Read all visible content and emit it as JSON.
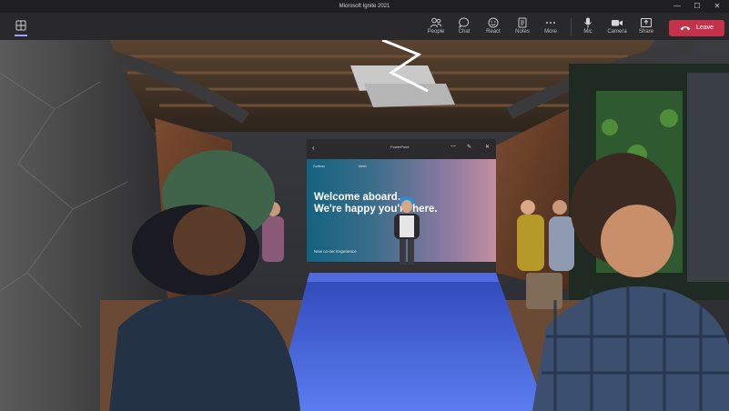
{
  "window": {
    "title": "Microsoft Ignite 2021",
    "minimize": "—",
    "maximize": "☐",
    "close": "✕"
  },
  "toolbar": {
    "items": [
      {
        "label": "People",
        "icon": "people-icon"
      },
      {
        "label": "Chat",
        "icon": "chat-icon"
      },
      {
        "label": "React",
        "icon": "react-icon"
      },
      {
        "label": "Notes",
        "icon": "notes-icon"
      },
      {
        "label": "More",
        "icon": "more-icon"
      },
      {
        "label": "Mic",
        "icon": "mic-icon"
      },
      {
        "label": "Camera",
        "icon": "camera-icon"
      },
      {
        "label": "Share",
        "icon": "share-icon"
      }
    ],
    "leave_label": "Leave",
    "leave_color": "#c4314b",
    "view_icon": "grid-view-icon",
    "accent": "#9ea1ff"
  },
  "panel": {
    "title": "PowerPoint",
    "slide_heading_line1": "Welcome aboard.",
    "slide_heading_line2": "We're happy you're here.",
    "slide_caption": "New co-ner Experience",
    "slide_top_left": "Contoso",
    "slide_top_mid": "Mesh"
  }
}
